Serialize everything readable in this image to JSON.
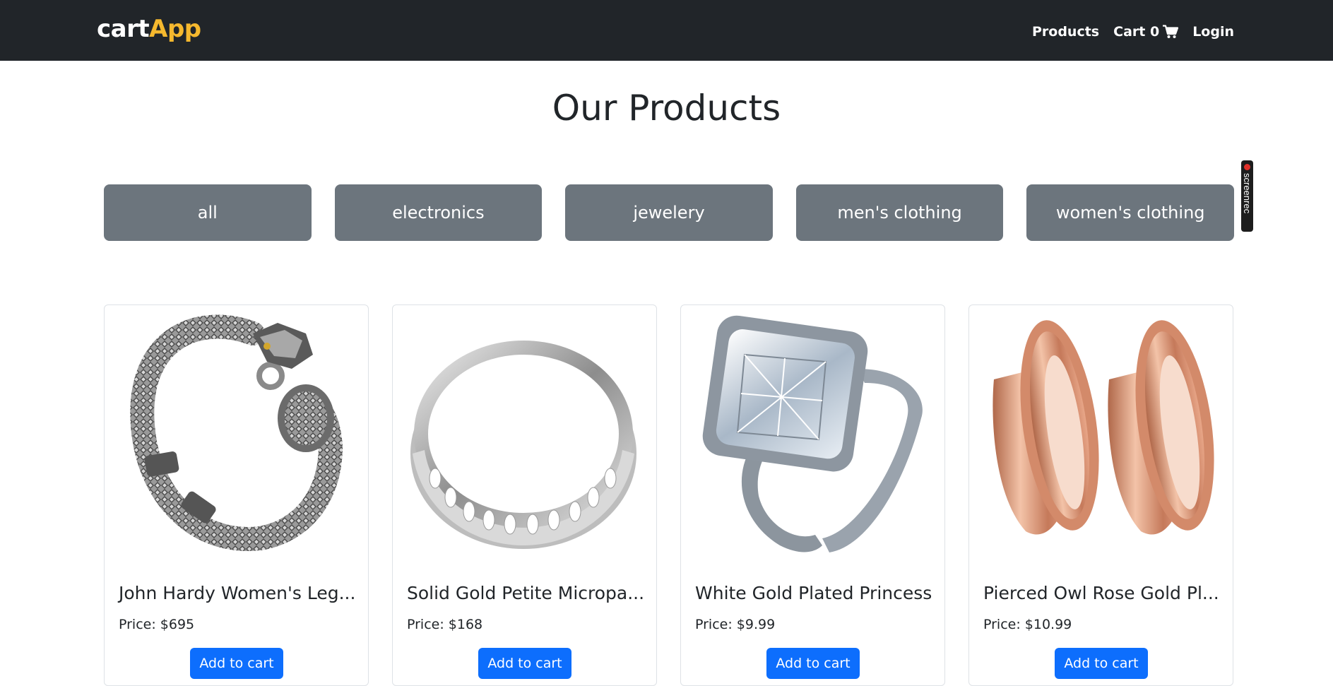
{
  "navbar": {
    "brand_part1": "cart",
    "brand_part2": "App",
    "brand_color": "#f5b82e",
    "links": {
      "products": "Products",
      "cart": "Cart 0",
      "login": "Login"
    },
    "cart_icon": "shopping-cart-icon"
  },
  "page": {
    "title": "Our Products"
  },
  "categories": [
    "all",
    "electronics",
    "jewelery",
    "men's clothing",
    "women's clothing"
  ],
  "overlay": {
    "screenrec_label": "screenrec"
  },
  "products": [
    {
      "title": "John Hardy Women's Leg...",
      "price": "Price: $695",
      "button": "Add to cart",
      "image": "silver-dragon-bracelet-image"
    },
    {
      "title": "Solid Gold Petite Micropa...",
      "price": "Price: $168",
      "button": "Add to cart",
      "image": "silver-band-ring-image"
    },
    {
      "title": "White Gold Plated Princess",
      "price": "Price: $9.99",
      "button": "Add to cart",
      "image": "diamond-ring-set-image"
    },
    {
      "title": "Pierced Owl Rose Gold Pl...",
      "price": "Price: $10.99",
      "button": "Add to cart",
      "image": "rose-gold-plugs-image"
    }
  ],
  "colors": {
    "navbar_bg": "#212529",
    "filter_bg": "#6c757d",
    "primary_button": "#0d6efd"
  }
}
